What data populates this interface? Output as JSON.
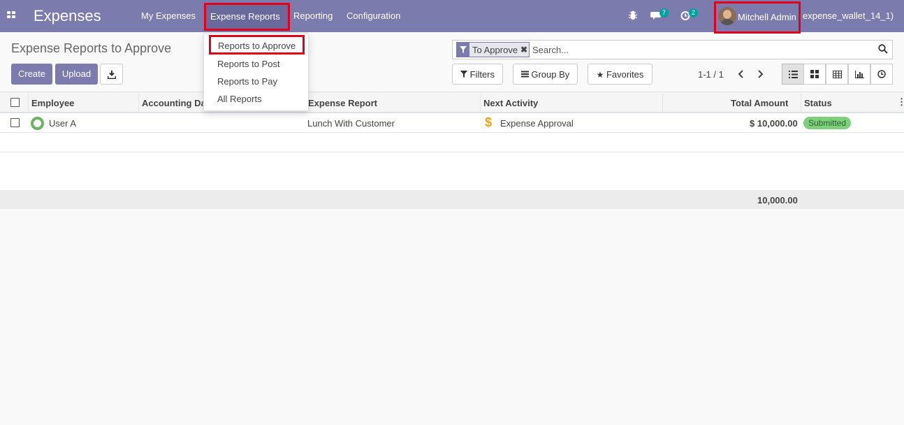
{
  "app": {
    "title": "Expenses"
  },
  "nav": {
    "items": [
      {
        "label": "My Expenses"
      },
      {
        "label": "Expense Reports"
      },
      {
        "label": "Reporting"
      },
      {
        "label": "Configuration"
      }
    ],
    "messages_count": "7",
    "activities_count": "2",
    "user_name": "Mitchell Admin",
    "database": "expense_wallet_14_1)"
  },
  "dropdown": {
    "items": [
      {
        "label": "Reports to Approve"
      },
      {
        "label": "Reports to Post"
      },
      {
        "label": "Reports to Pay"
      },
      {
        "label": "All Reports"
      }
    ]
  },
  "control": {
    "breadcrumb": "Expense Reports to Approve",
    "create_label": "Create",
    "upload_label": "Upload",
    "search_facet": "To Approve",
    "search_placeholder": "Search...",
    "filters_label": "Filters",
    "groupby_label": "Group By",
    "favorites_label": "Favorites",
    "pager": "1-1 / 1"
  },
  "table": {
    "columns": [
      {
        "label": "Employee"
      },
      {
        "label": "Accounting Da"
      },
      {
        "label": "Expense Report"
      },
      {
        "label": "Next Activity"
      },
      {
        "label": "Total Amount"
      },
      {
        "label": "Status"
      }
    ],
    "rows": [
      {
        "employee": "User A",
        "accounting_date": "",
        "expense_report": "Lunch With Customer",
        "next_activity": "Expense Approval",
        "total_amount": "$ 10,000.00",
        "status": "Submitted"
      }
    ],
    "total": "10,000.00"
  },
  "colors": {
    "brand": "#7c7bad",
    "highlight": "#e2001a",
    "status_submitted": "#7ed07e",
    "activity_dollar": "#f0a30a"
  }
}
